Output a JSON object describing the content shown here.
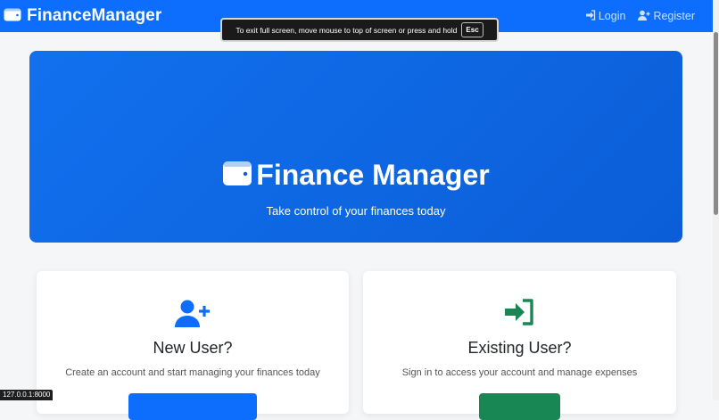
{
  "navbar": {
    "brand": "FinanceManager",
    "links": [
      {
        "label": "Login",
        "icon": "login-icon"
      },
      {
        "label": "Register",
        "icon": "user-plus-icon"
      }
    ]
  },
  "fullscreen_notice": {
    "message": "To exit full screen, move mouse to top of screen or press and hold",
    "key": "Esc"
  },
  "hero": {
    "title": "Finance Manager",
    "subtitle": "Take control of your finances today",
    "icon": "wallet-icon"
  },
  "cards": [
    {
      "icon": "user-plus-icon",
      "title": "New User?",
      "text": "Create an account and start managing your finances today",
      "button_label": "",
      "button_color": "#0d6efd"
    },
    {
      "icon": "sign-in-icon",
      "title": "Existing User?",
      "text": "Sign in to access your account and manage expenses",
      "button_label": "",
      "button_color": "#198754"
    }
  ],
  "status_bar": {
    "url": "127.0.0.1:8000"
  },
  "colors": {
    "primary": "#0d6efd",
    "success": "#198754",
    "background": "#f5f6f8"
  }
}
